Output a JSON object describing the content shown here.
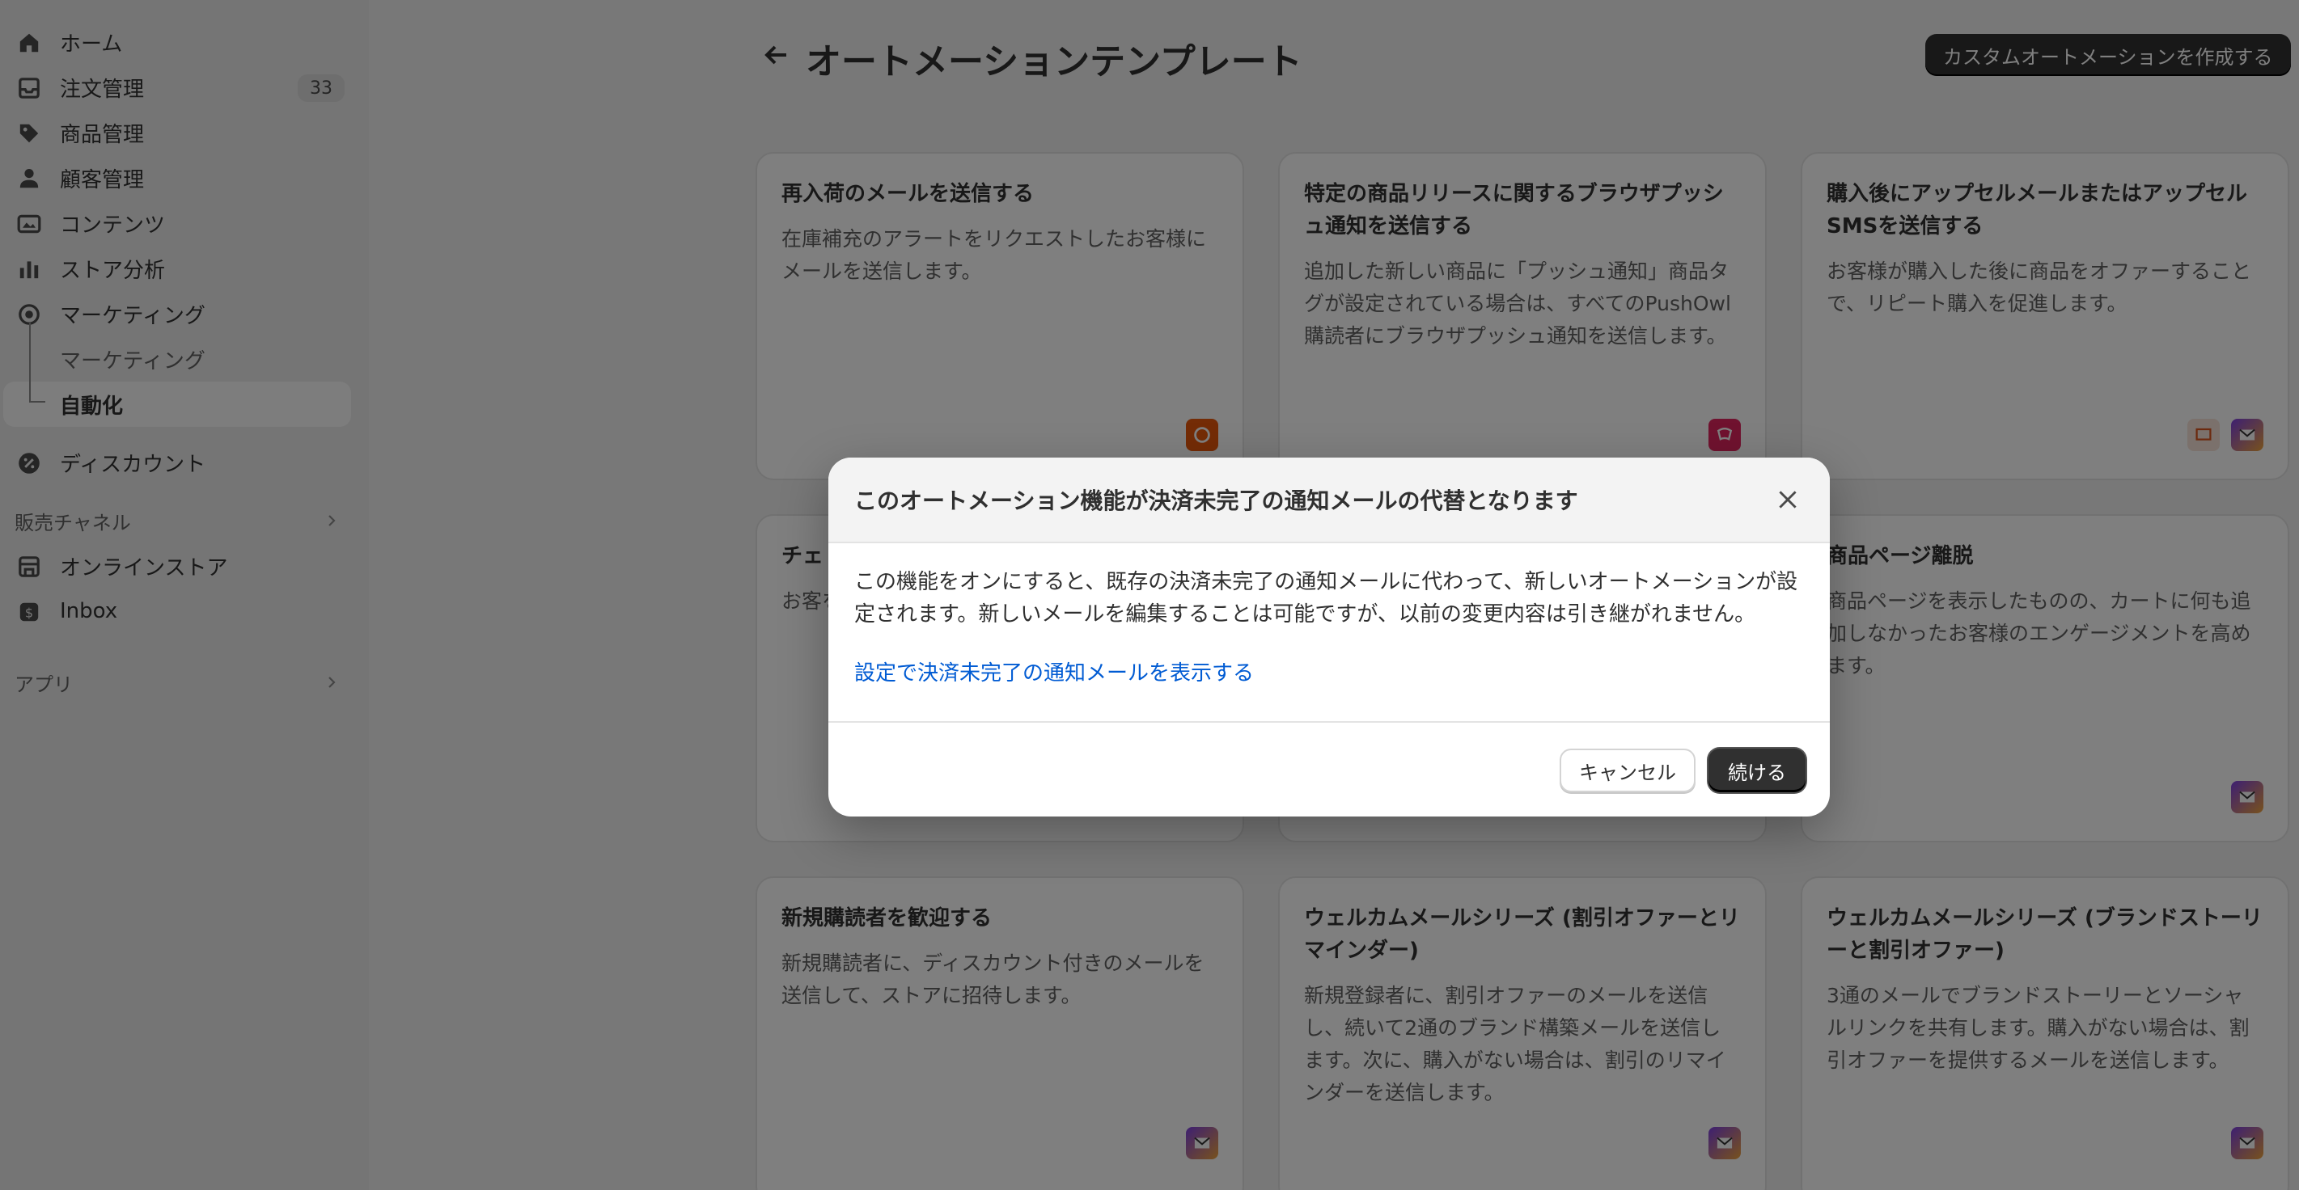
{
  "sidebar": {
    "items": [
      {
        "label": "ホーム",
        "icon": "home-icon"
      },
      {
        "label": "注文管理",
        "icon": "inbox-icon",
        "badge": "33"
      },
      {
        "label": "商品管理",
        "icon": "tag-icon"
      },
      {
        "label": "顧客管理",
        "icon": "person-icon"
      },
      {
        "label": "コンテンツ",
        "icon": "image-icon"
      },
      {
        "label": "ストア分析",
        "icon": "bar-chart-icon"
      },
      {
        "label": "マーケティング",
        "icon": "target-icon"
      }
    ],
    "marketing_sub": [
      {
        "label": "マーケティング"
      },
      {
        "label": "自動化"
      }
    ],
    "discount": {
      "label": "ディスカウント",
      "icon": "discount-icon"
    },
    "sales_channels": {
      "heading": "販売チャネル"
    },
    "channels": [
      {
        "label": "オンラインストア",
        "icon": "store-icon"
      },
      {
        "label": "Inbox",
        "icon": "inbox-chat-icon"
      }
    ],
    "apps": {
      "heading": "アプリ"
    }
  },
  "header": {
    "title": "オートメーションテンプレート",
    "create_button": "カスタムオートメーションを作成する"
  },
  "cards": [
    {
      "title": "再入荷のメールを送信する",
      "desc": "在庫補充のアラートをリクエストしたお客様にメールを送信します。"
    },
    {
      "title": "特定の商品リリースに関するブラウザプッシュ通知を送信する",
      "desc": "追加した新しい商品に「プッシュ通知」商品タグが設定されている場合は、すべてのPushOwl購読者にブラウザプッシュ通知を送信します。"
    },
    {
      "title": "購入後にアップセルメールまたはアップセルSMSを送信する",
      "desc": "お客様が購入した後に商品をオファーすることで、リピート購入を促進します。"
    },
    {
      "title": "チェ",
      "desc": "お客を完"
    },
    {
      "title": "",
      "desc": ""
    },
    {
      "title": "商品ページ離脱",
      "desc": "商品ページを表示したものの、カートに何も追加しなかったお客様のエンゲージメントを高めます。"
    },
    {
      "title": "新規購読者を歓迎する",
      "desc": "新規購読者に、ディスカウント付きのメールを送信して、ストアに招待します。"
    },
    {
      "title": "ウェルカムメールシリーズ (割引オファーとリマインダー)",
      "desc": "新規登録者に、割引オファーのメールを送信し、続いて2通のブランド構築メールを送信します。次に、購入がない場合は、割引のリマインダーを送信します。"
    },
    {
      "title": "ウェルカムメールシリーズ (ブランドストーリーと割引オファー)",
      "desc": "3通のメールでブランドストーリーとソーシャルリンクを共有します。購入がない場合は、割引オファーを提供するメールを送信します。"
    }
  ],
  "modal": {
    "title": "このオートメーション機能が決済未完了の通知メールの代替となります",
    "body": "この機能をオンにすると、既存の決済未完了の通知メールに代わって、新しいオートメーションが設定されます。新しいメールを編集することは可能ですが、以前の変更内容は引き継がれません。",
    "link": "設定で決済未完了の通知メールを表示する",
    "cancel": "キャンセル",
    "continue": "続ける"
  },
  "colors": {
    "link": "#005bd3",
    "primary_button": "#303030",
    "app_orange": "#e8590c",
    "app_pink": "#e0245e",
    "app_purple_gradient": "#b44fd6"
  }
}
